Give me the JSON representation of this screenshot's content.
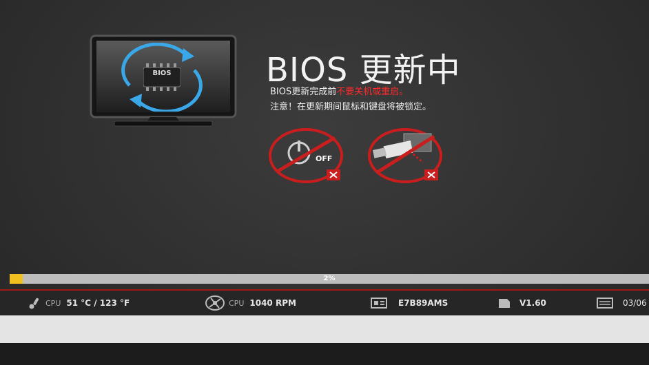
{
  "headline": "BIOS 更新中",
  "notice": {
    "line1_prefix": "BIOS更新完成前",
    "line1_warning": "不要关机或重启。",
    "line2": "注意！在更新期间鼠标和键盘将被锁定。"
  },
  "illustration": {
    "chip_label": "BIOS",
    "power_label": "OFF"
  },
  "progress": {
    "value": 0.02,
    "text": "2%"
  },
  "status": {
    "cpu_temp_label": "CPU",
    "cpu_temp_value": "51 °C / 123 °F",
    "cpu_fan_label": "CPU",
    "cpu_fan_value": "1040 RPM",
    "board_model": "E7B89AMS",
    "bios_version": "V1.60",
    "date": "03/06"
  },
  "colors": {
    "warning_red": "#ff2a2a",
    "accent_red": "#c81e1e",
    "progress_fill": "#f0c020"
  },
  "icons": [
    "monitor-icon",
    "bios-chip-icon",
    "refresh-arrows-icon",
    "power-off-icon",
    "usb-drive-icon",
    "thermometer-icon",
    "fan-icon",
    "motherboard-icon",
    "bios-chip-small-icon",
    "calendar-icon"
  ]
}
